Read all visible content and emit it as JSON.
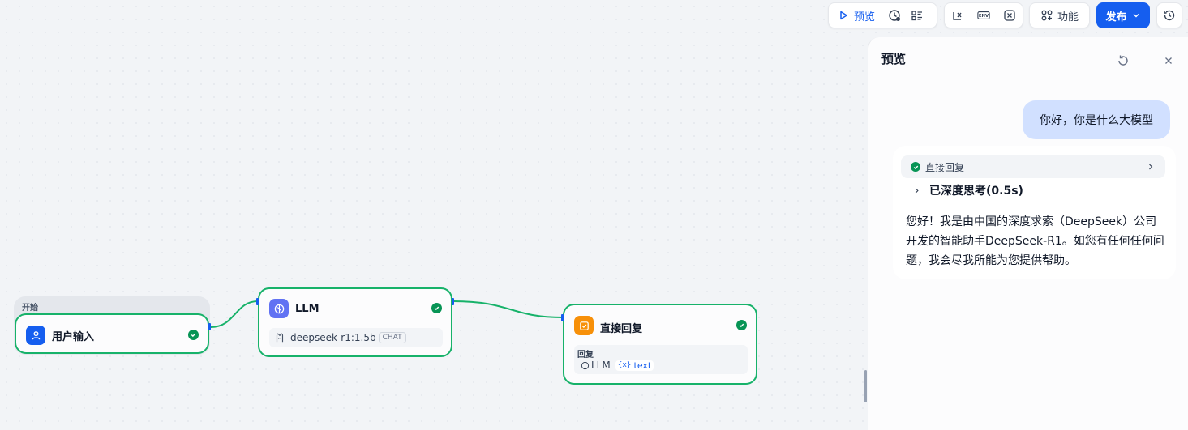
{
  "toolbar": {
    "preview_label": "预览",
    "features_label": "功能",
    "publish_label": "发布",
    "env_icon_text": "ENV"
  },
  "canvas": {
    "start_group_label": "开始",
    "nodes": {
      "user_input": {
        "title": "用户输入",
        "status": "success"
      },
      "llm": {
        "title": "LLM",
        "model": "deepseek-r1:1.5b",
        "mode_badge": "CHAT",
        "status": "success"
      },
      "direct_reply": {
        "title": "直接回复",
        "field_label": "回复",
        "var_source": "LLM",
        "var_name": "text",
        "status": "success"
      }
    }
  },
  "panel": {
    "title": "预览",
    "user_message": "你好，你是什么大模型",
    "workflow_step": "直接回复",
    "thinking_label": "已深度思考(0.5s)",
    "answer": "您好！我是由中国的深度求索（DeepSeek）公司开发的智能助手DeepSeek-R1。如您有任何任何问题，我会尽我所能为您提供帮助。"
  },
  "colors": {
    "accent": "#155eef",
    "success": "#17b26a",
    "llm_icon": "#6172f3",
    "reply_icon": "#f79009",
    "user_bubble": "#d1e0ff"
  }
}
